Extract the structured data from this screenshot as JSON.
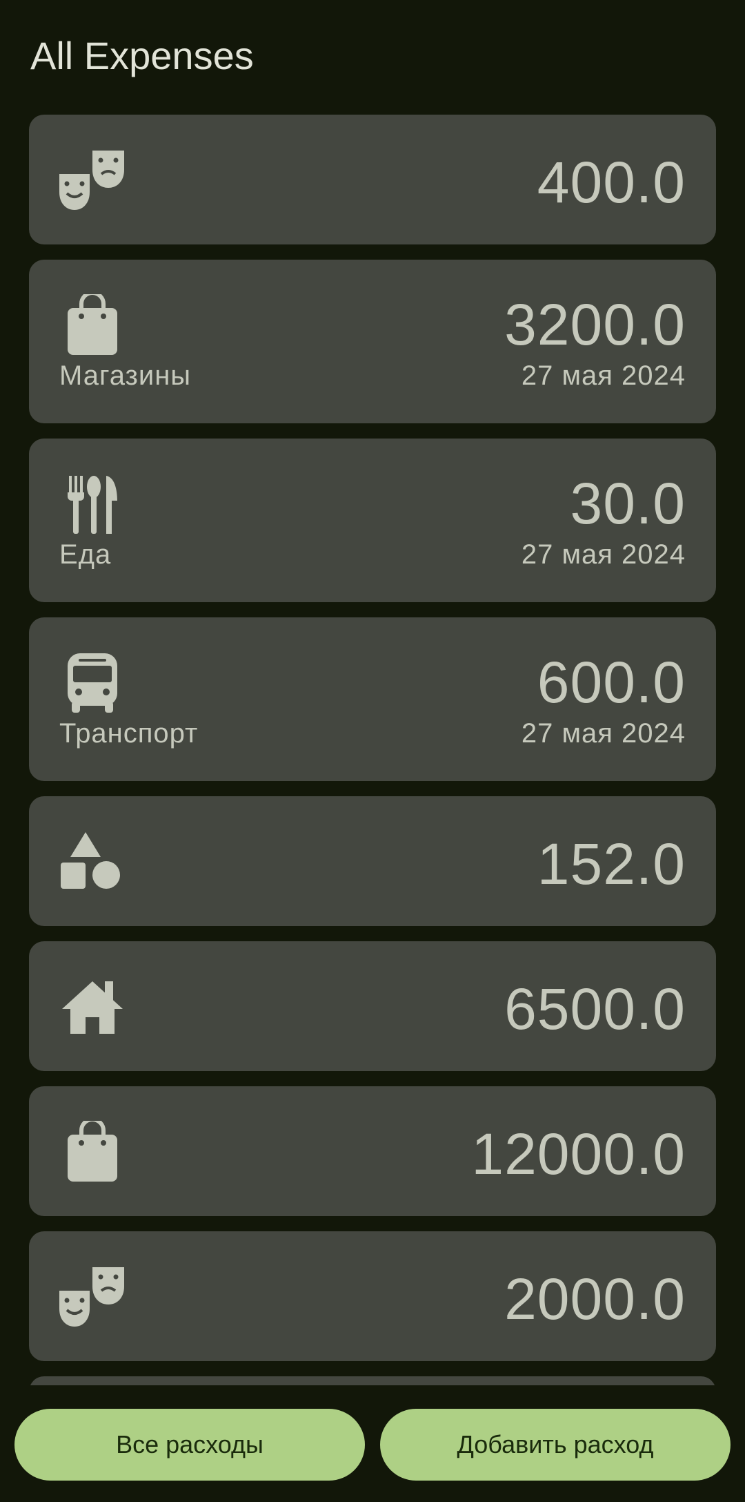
{
  "header": {
    "title": "All Expenses"
  },
  "colors": {
    "background": "#121709",
    "card": "#444740",
    "text": "#c6c9bc",
    "button": "#aed085"
  },
  "expenses": [
    {
      "icon": "theater-masks-icon",
      "amount": "400.0",
      "category": "",
      "date": ""
    },
    {
      "icon": "shopping-bag-icon",
      "amount": "3200.0",
      "category": "Магазины",
      "date": "27 мая 2024"
    },
    {
      "icon": "restaurant-icon",
      "amount": "30.0",
      "category": "Еда",
      "date": "27 мая 2024"
    },
    {
      "icon": "bus-icon",
      "amount": "600.0",
      "category": "Транспорт",
      "date": "27 мая 2024"
    },
    {
      "icon": "shapes-icon",
      "amount": "152.0",
      "category": "",
      "date": ""
    },
    {
      "icon": "home-icon",
      "amount": "6500.0",
      "category": "",
      "date": ""
    },
    {
      "icon": "shopping-bag-icon",
      "amount": "12000.0",
      "category": "",
      "date": ""
    },
    {
      "icon": "theater-masks-icon",
      "amount": "2000.0",
      "category": "",
      "date": ""
    }
  ],
  "bottom_bar": {
    "all_expenses_label": "Все расходы",
    "add_expense_label": "Добавить расход"
  }
}
